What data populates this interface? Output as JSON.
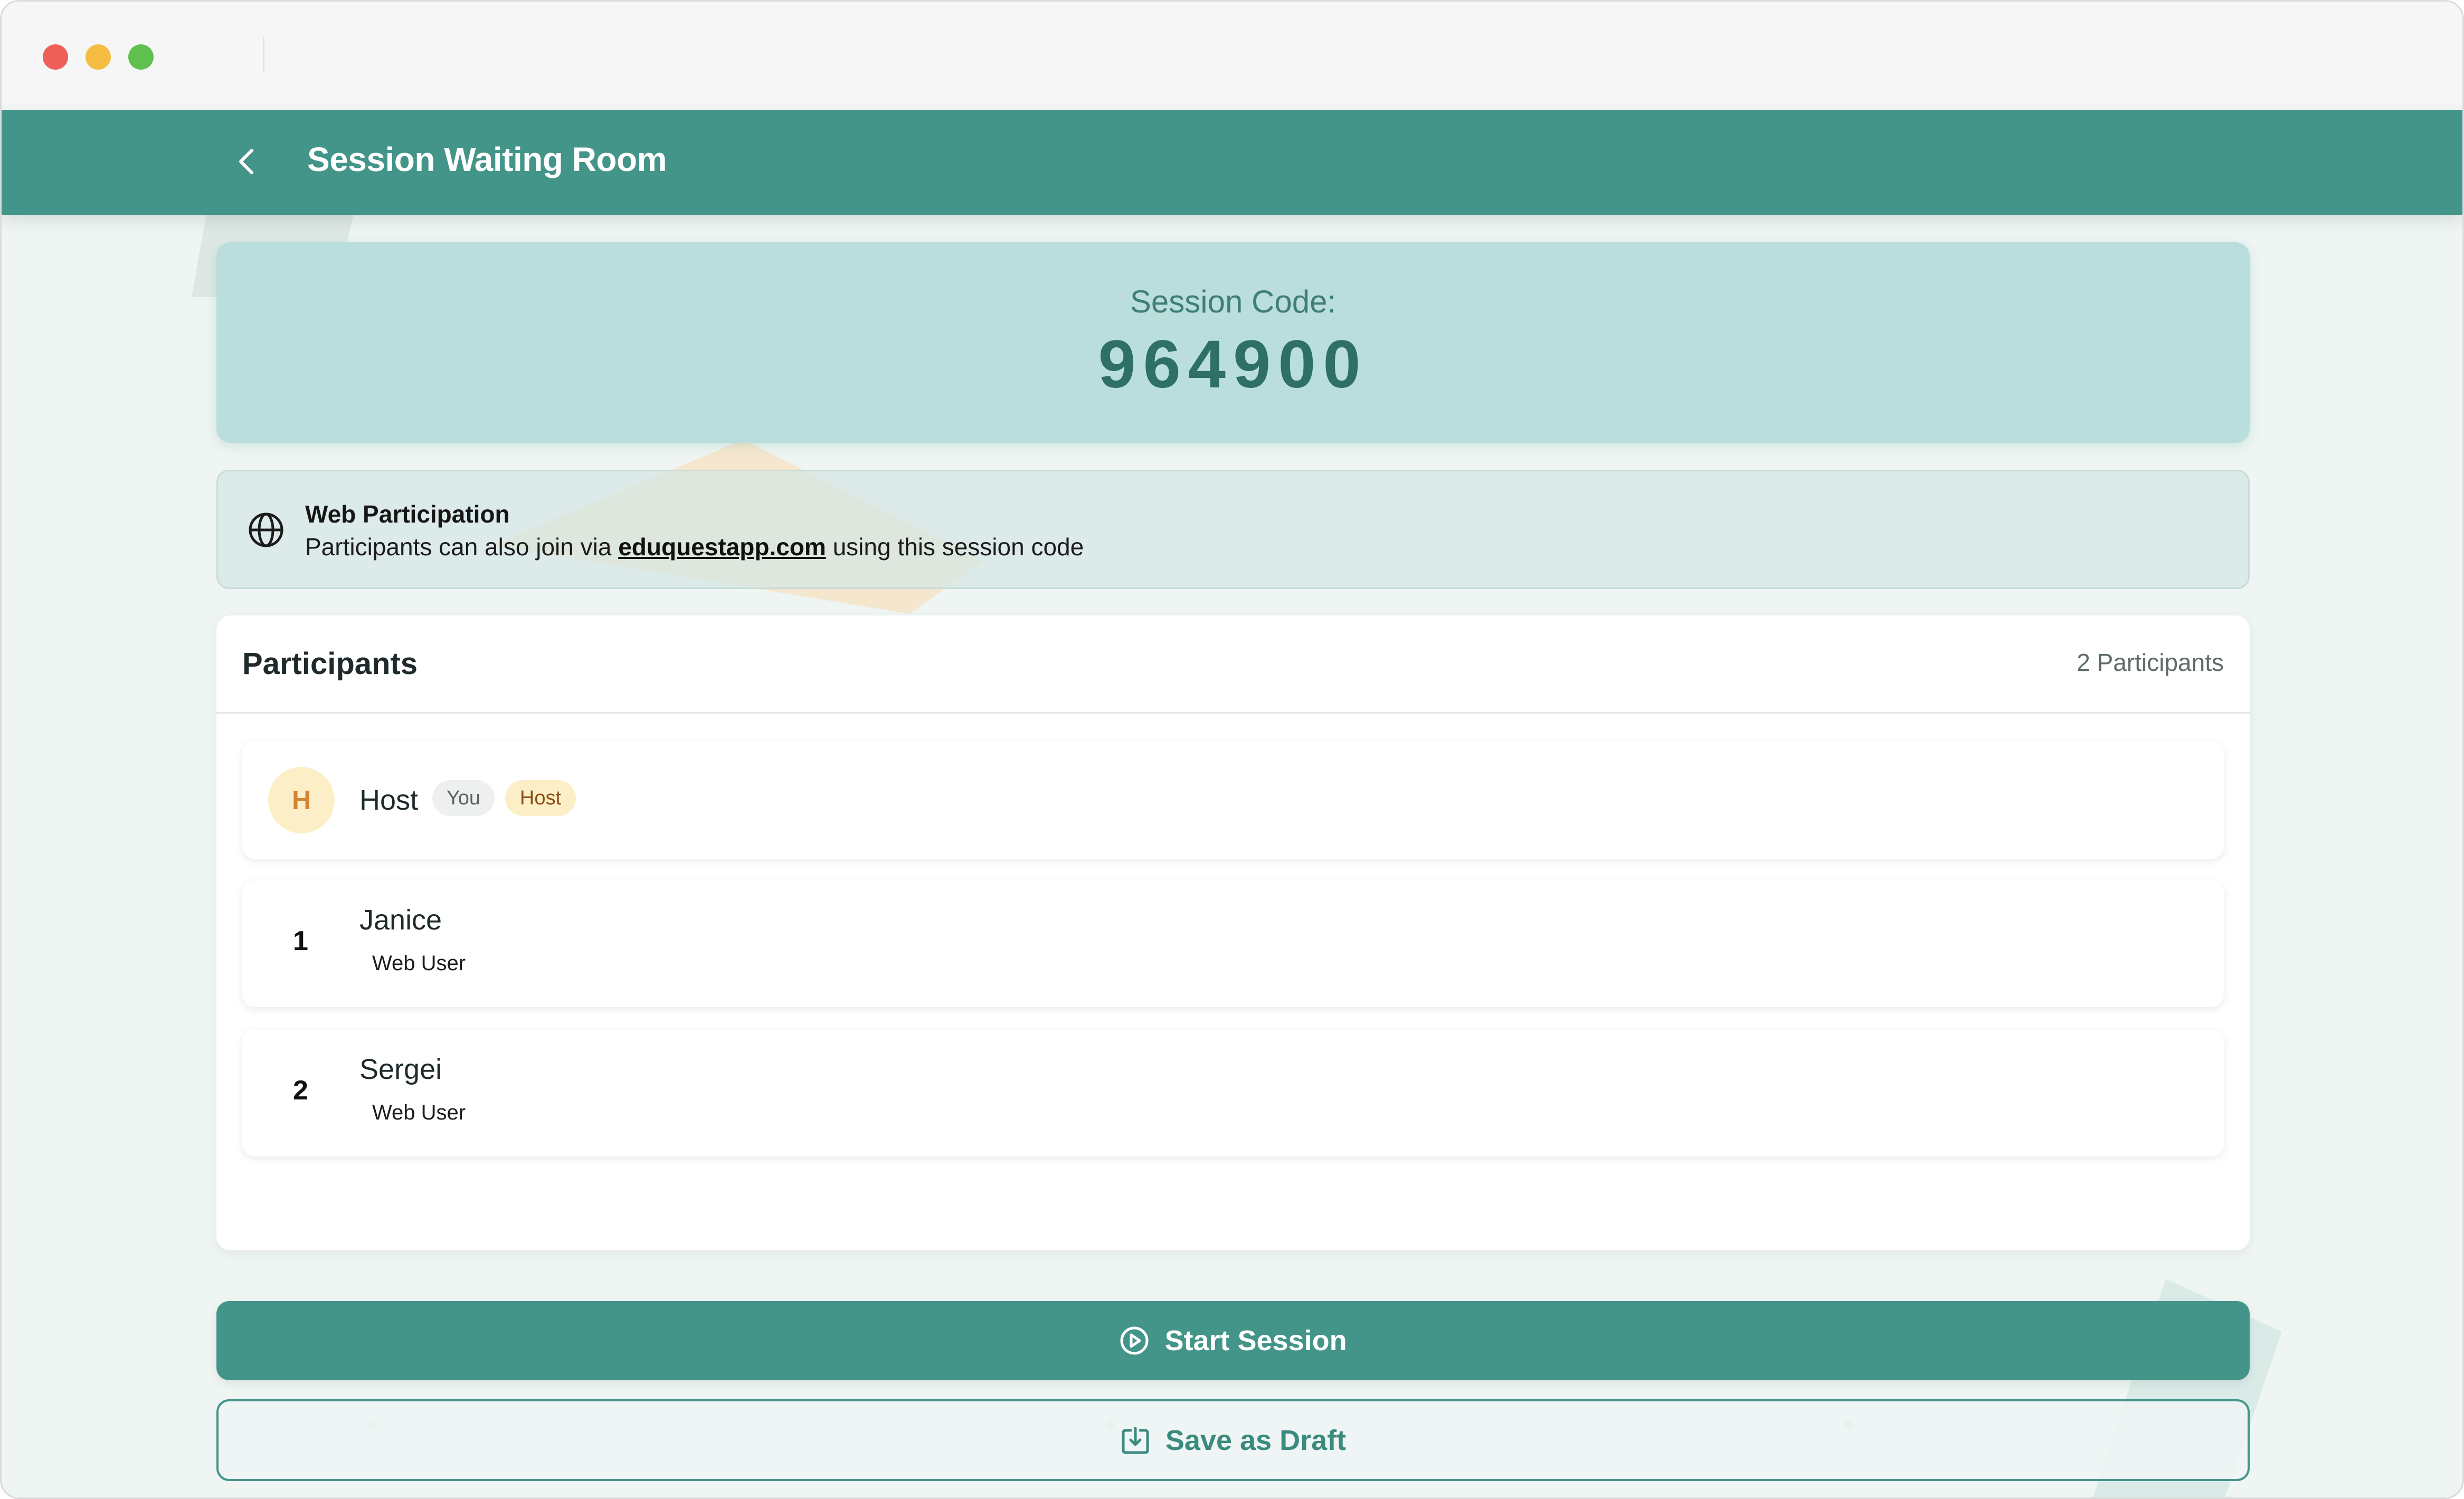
{
  "window": {
    "controls": [
      "close",
      "minimize",
      "maximize"
    ]
  },
  "header": {
    "title": "Session Waiting Room",
    "back_icon": "chevron-left-icon"
  },
  "session": {
    "code_label": "Session Code:",
    "code": "964900"
  },
  "web_participation": {
    "icon": "globe-icon",
    "title": "Web Participation",
    "desc_before": "Participants can also join via",
    "link_text": "eduquestapp.com",
    "desc_after": "using this session code"
  },
  "participants": {
    "title": "Participants",
    "count_label": "2 Participants",
    "host": {
      "avatar_letter": "H",
      "name": "Host",
      "badge_you": "You",
      "badge_host": "Host"
    },
    "list": [
      {
        "index": "1",
        "name": "Janice",
        "subtitle": "Web User"
      },
      {
        "index": "2",
        "name": "Sergei",
        "subtitle": "Web User"
      }
    ]
  },
  "actions": {
    "start_label": "Start Session",
    "start_icon": "play-circle-icon",
    "draft_label": "Save as Draft",
    "draft_icon": "download-tray-icon"
  },
  "colors": {
    "primary": "#439589",
    "code_card_bg": "#b9dedb",
    "host_avatar_bg": "#fcefc8",
    "host_avatar_text": "#d38434"
  }
}
